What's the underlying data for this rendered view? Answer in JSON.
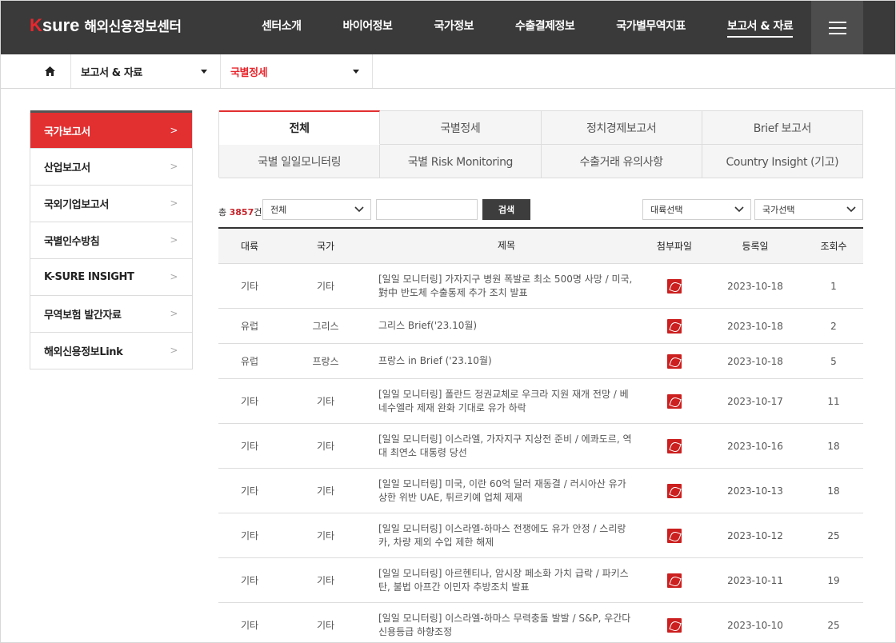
{
  "header": {
    "logo_k": "K",
    "logo_sure": "sure",
    "logo_title": "해외신용정보센터",
    "nav": [
      "센터소개",
      "바이어정보",
      "국가정보",
      "수출결제정보",
      "국가별무역지표",
      "보고서 & 자료"
    ],
    "active_nav_index": 5
  },
  "breadcrumb": {
    "level1": "보고서 & 자료",
    "level2": "국별정세"
  },
  "sidebar": {
    "items": [
      "국가보고서",
      "산업보고서",
      "국외기업보고서",
      "국별인수방침",
      "K-SURE INSIGHT",
      "무역보험 발간자료",
      "해외신용정보Link"
    ],
    "active_index": 0
  },
  "tabs": {
    "items": [
      "전체",
      "국별정세",
      "정치경제보고서",
      "Brief 보고서",
      "국별 일일모니터링",
      "국별 Risk Monitoring",
      "수출거래 유의사항",
      "Country Insight (기고)"
    ],
    "active_index": 0
  },
  "search": {
    "total_prefix": "총",
    "total_count": "3857",
    "total_suffix": "건",
    "category_value": "전체",
    "keyword_value": "",
    "button_label": "검색",
    "region_value": "대륙선택",
    "country_value": "국가선택"
  },
  "table": {
    "columns": [
      "대륙",
      "국가",
      "제목",
      "첨부파일",
      "등록일",
      "조회수"
    ],
    "rows": [
      {
        "region": "기타",
        "country": "기타",
        "title": "[일일 모니터링] 가자지구 병원 폭발로 최소 500명 사망 / 미국, 對中 반도체 수출통제 추가 조치 발표",
        "date": "2023-10-18",
        "views": "1"
      },
      {
        "region": "유럽",
        "country": "그리스",
        "title": "그리스 Brief('23.10월)",
        "date": "2023-10-18",
        "views": "2"
      },
      {
        "region": "유럽",
        "country": "프랑스",
        "title": "프랑스 in Brief ('23.10월)",
        "date": "2023-10-18",
        "views": "5"
      },
      {
        "region": "기타",
        "country": "기타",
        "title": "[일일 모니터링] 폴란드 정권교체로 우크라 지원 재개 전망 / 베네수엘라 제재 완화 기대로 유가 하락",
        "date": "2023-10-17",
        "views": "11"
      },
      {
        "region": "기타",
        "country": "기타",
        "title": "[일일 모니터링] 이스라엘, 가자지구 지상전 준비 / 에콰도르, 역대 최연소 대통령 당선",
        "date": "2023-10-16",
        "views": "18"
      },
      {
        "region": "기타",
        "country": "기타",
        "title": "[일일 모니터링] 미국, 이란 60억 달러 재동결 / 러시아산 유가상한 위반 UAE, 튀르키예 업체 제재",
        "date": "2023-10-13",
        "views": "18"
      },
      {
        "region": "기타",
        "country": "기타",
        "title": "[일일 모니터링] 이스라엘-하마스 전쟁에도 유가 안정 / 스리랑카, 차량 제외 수입 제한 해제",
        "date": "2023-10-12",
        "views": "25"
      },
      {
        "region": "기타",
        "country": "기타",
        "title": "[일일 모니터링] 아르헨티나, 암시장 페소화 가치 급락 / 파키스탄, 불법 아프간 이민자 추방조치 발표",
        "date": "2023-10-11",
        "views": "19"
      },
      {
        "region": "기타",
        "country": "기타",
        "title": "[일일 모니터링] 이스라엘-하마스 무력충돌 발발 / S&P, 우간다 신용등급 하향조정",
        "date": "2023-10-10",
        "views": "25"
      }
    ]
  },
  "colors": {
    "accent": "#e22f30",
    "header_bg": "#3a3a3a"
  }
}
